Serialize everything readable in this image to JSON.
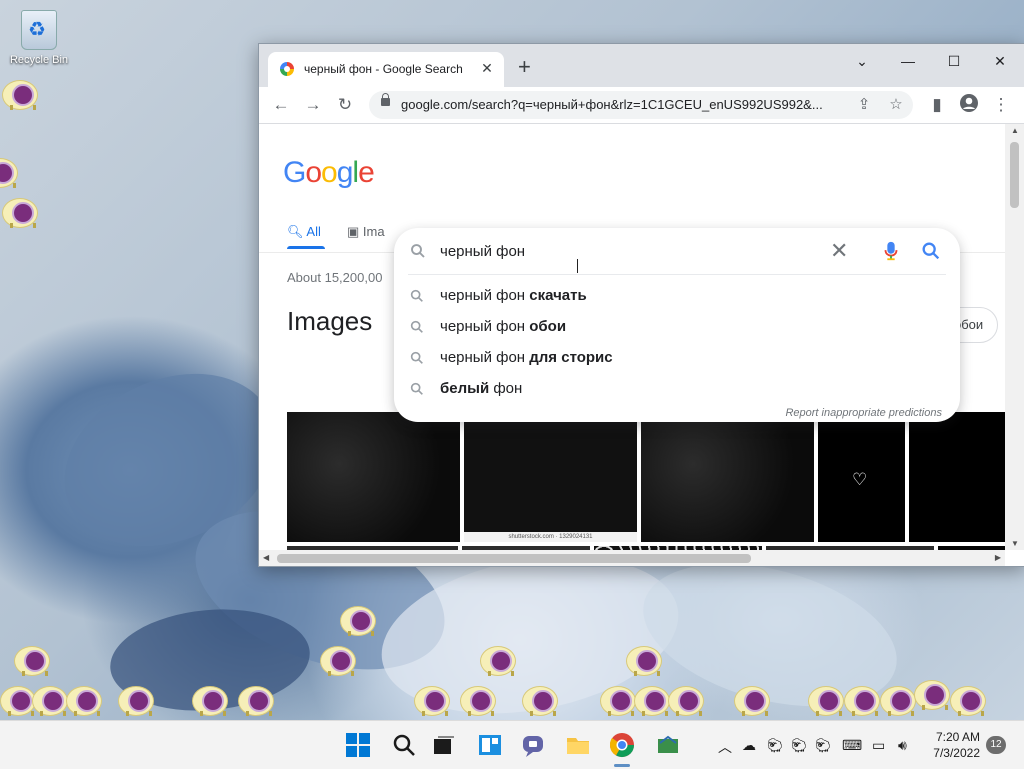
{
  "desktop": {
    "recycle_bin_label": "Recycle Bin"
  },
  "browser": {
    "tab_title": "черный фон - Google Search",
    "new_tab_symbol": "+",
    "url": "google.com/search?q=черный+фон&rlz=1C1GCEU_enUS992US992&...",
    "window_controls": {
      "tabsearch": "⌄",
      "minimize": "—",
      "maximize": "☐",
      "close": "✕"
    }
  },
  "page": {
    "logo_letters": [
      {
        "ch": "G",
        "color": "#4285f4"
      },
      {
        "ch": "o",
        "color": "#ea4335"
      },
      {
        "ch": "o",
        "color": "#fbbc05"
      },
      {
        "ch": "g",
        "color": "#4285f4"
      },
      {
        "ch": "l",
        "color": "#34a853"
      },
      {
        "ch": "e",
        "color": "#ea4335"
      }
    ],
    "tab_all": "All",
    "tab_images": "Ima",
    "result_stats": "About 15,200,00",
    "images_heading": "Images",
    "chip_label": "обои",
    "image_caption": "shutterstock.com · 1329024131"
  },
  "search": {
    "query": "черный фон",
    "suggestions": [
      {
        "normal": "черный фон ",
        "bold": "скачать"
      },
      {
        "normal": "черный фон ",
        "bold": "обои"
      },
      {
        "normal": "черный фон ",
        "bold": "для сторис"
      },
      {
        "normal": "",
        "bold": "белый",
        "tail": " фон"
      }
    ],
    "report_link": "Report inappropriate predictions"
  },
  "taskbar": {
    "time": "7:20 AM",
    "date": "7/3/2022",
    "notification_count": "12"
  }
}
